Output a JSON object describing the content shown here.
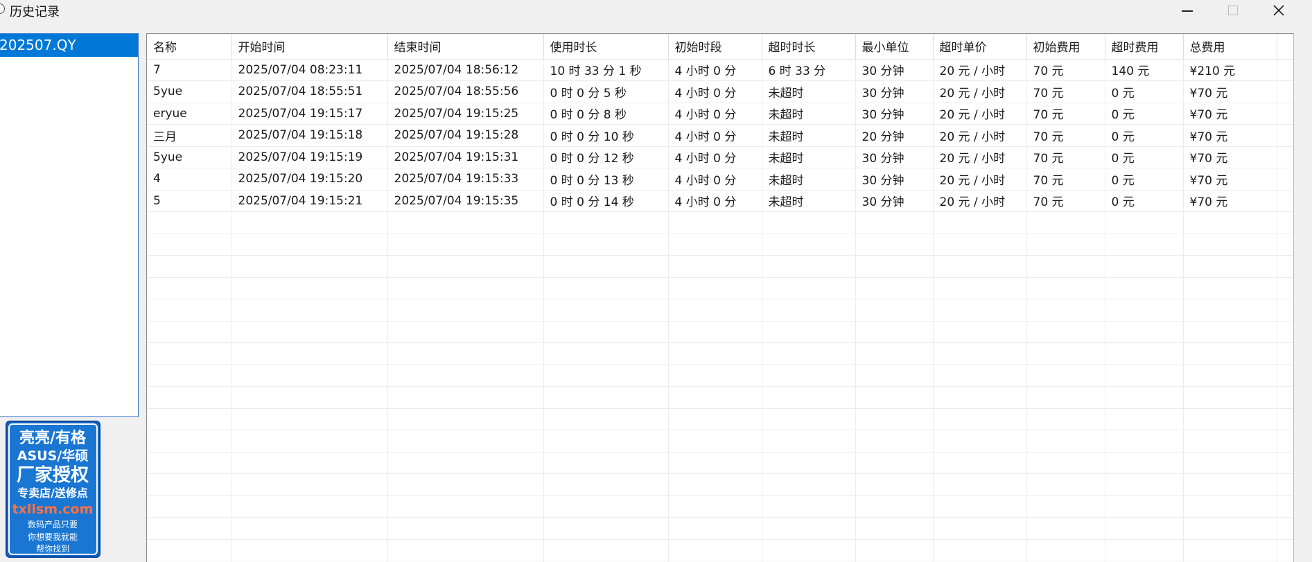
{
  "window": {
    "title": "历史记录"
  },
  "left_list": {
    "items": [
      "202507.QY"
    ]
  },
  "watermark": {
    "lines": [
      "亮亮/有格",
      "ASUS/华硕",
      "厂家授权",
      "专卖店/送修点",
      "txllsm.com",
      "数码产品只要",
      "你想要我就能",
      "帮你找到"
    ]
  },
  "table": {
    "columns": [
      "名称",
      "开始时间",
      "结束时间",
      "使用时长",
      "初始时段",
      "超时时长",
      "最小单位",
      "超时单价",
      "初始费用",
      "超时费用",
      "总费用"
    ],
    "rows": [
      [
        "7",
        "2025/07/04 08:23:11",
        "2025/07/04 18:56:12",
        "10 时 33 分 1 秒",
        "4 小时 0 分",
        "6 时 33 分",
        "30 分钟",
        "20 元 / 小时",
        "70 元",
        "140 元",
        "¥210 元"
      ],
      [
        "5yue",
        "2025/07/04 18:55:51",
        "2025/07/04 18:55:56",
        "0 时 0 分 5 秒",
        "4 小时 0 分",
        "未超时",
        "30 分钟",
        "20 元 / 小时",
        "70 元",
        "0 元",
        "¥70 元"
      ],
      [
        "eryue",
        "2025/07/04 19:15:17",
        "2025/07/04 19:15:25",
        "0 时 0 分 8 秒",
        "4 小时 0 分",
        "未超时",
        "30 分钟",
        "20 元 / 小时",
        "70 元",
        "0 元",
        "¥70 元"
      ],
      [
        "三月",
        "2025/07/04 19:15:18",
        "2025/07/04 19:15:28",
        "0 时 0 分 10 秒",
        "4 小时 0 分",
        "未超时",
        "20 分钟",
        "20 元 / 小时",
        "70 元",
        "0 元",
        "¥70 元"
      ],
      [
        "5yue",
        "2025/07/04 19:15:19",
        "2025/07/04 19:15:31",
        "0 时 0 分 12 秒",
        "4 小时 0 分",
        "未超时",
        "30 分钟",
        "20 元 / 小时",
        "70 元",
        "0 元",
        "¥70 元"
      ],
      [
        "4",
        "2025/07/04 19:15:20",
        "2025/07/04 19:15:33",
        "0 时 0 分 13 秒",
        "4 小时 0 分",
        "未超时",
        "30 分钟",
        "20 元 / 小时",
        "70 元",
        "0 元",
        "¥70 元"
      ],
      [
        "5",
        "2025/07/04 19:15:21",
        "2025/07/04 19:15:35",
        "0 时 0 分 14 秒",
        "4 小时 0 分",
        "未超时",
        "30 分钟",
        "20 元 / 小时",
        "70 元",
        "0 元",
        "¥70 元"
      ]
    ]
  }
}
